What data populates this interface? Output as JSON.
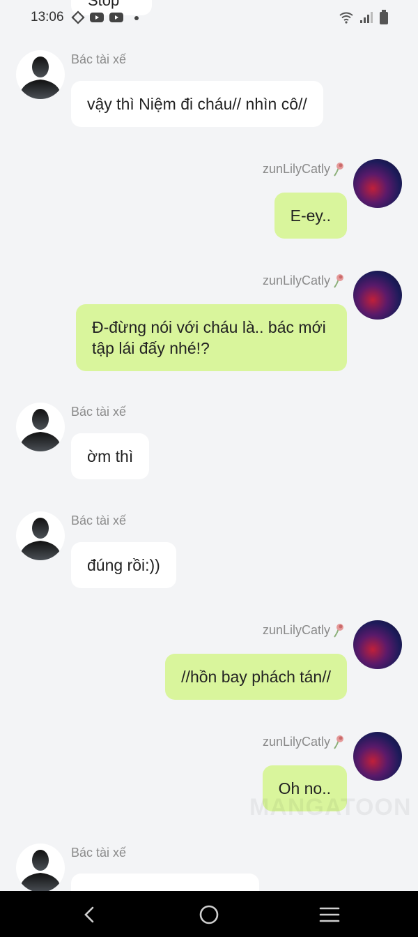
{
  "status_bar": {
    "time": "13:06"
  },
  "clipped_top_message": {
    "text": "Stop"
  },
  "messages": [
    {
      "sender": "Bác tài xế",
      "text": "vậy thì Niệm đi cháu// nhìn cô//"
    },
    {
      "sender": "zunLilyCatly",
      "text": "E-ey.."
    },
    {
      "sender": "zunLilyCatly",
      "text": "Đ-đừng nói với cháu là.. bác mới tập lái đấy nhé!?"
    },
    {
      "sender": "Bác tài xế",
      "text": "ờm thì"
    },
    {
      "sender": "Bác tài xế",
      "text": "đúng rồi:))"
    },
    {
      "sender": "zunLilyCatly",
      "text": "//hồn bay phách tán//"
    },
    {
      "sender": "zunLilyCatly",
      "text": "Oh no.."
    },
    {
      "sender": "Bác tài xế",
      "text": ""
    }
  ],
  "watermark": "MANGATOON",
  "icons": {
    "driver_avatar": "person-silhouette-icon",
    "lily_avatar": "profile-photo",
    "rose_badge": "wilted-rose-icon",
    "nav_back": "back-chevron-icon",
    "nav_home": "home-circle-icon",
    "nav_menu": "menu-icon"
  },
  "colors": {
    "background": "#f3f4f6",
    "left_bubble": "#ffffff",
    "right_bubble": "#d9f59c",
    "sender_name": "#8a8a8a",
    "nav_bar": "#000000"
  }
}
